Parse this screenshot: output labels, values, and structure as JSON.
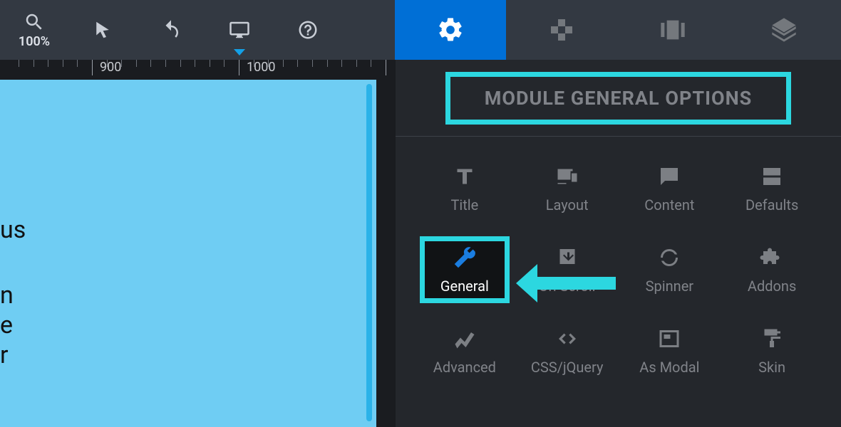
{
  "colors": {
    "accent_blue": "#006fd6",
    "highlight_cyan": "#2cd7e0",
    "canvas": "#6fcdf3"
  },
  "toolbar": {
    "zoom_label": "100%",
    "ruler_900": "900",
    "ruler_1000": "1000"
  },
  "canvas_text": {
    "line1": "us",
    "line2": "n",
    "line3": "e",
    "line4": "r"
  },
  "panel": {
    "header": "MODULE GENERAL OPTIONS",
    "options": {
      "title": "Title",
      "layout": "Layout",
      "content": "Content",
      "defaults": "Defaults",
      "general": "General",
      "onscroll": "On Scroll",
      "spinner": "Spinner",
      "addons": "Addons",
      "advanced": "Advanced",
      "cssjquery": "CSS/jQuery",
      "asmodal": "As Modal",
      "skin": "Skin"
    }
  }
}
